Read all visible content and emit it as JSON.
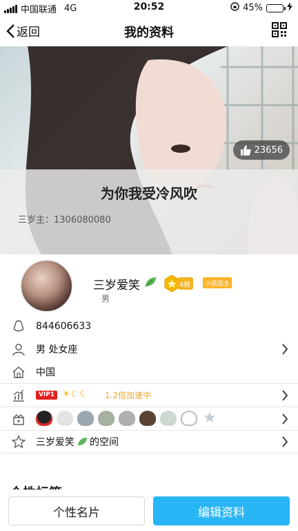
{
  "status_bar": {
    "carrier": "中国联通",
    "network": "4G",
    "time": "20:52",
    "battery": "45%",
    "battery_level": 0.45
  },
  "nav": {
    "back_label": "返回",
    "title": "我的资料"
  },
  "hero": {
    "likes": "23656",
    "signature": "为你我受冷风吹",
    "owner": "三岁主：1306080080"
  },
  "profile": {
    "name": "三岁爱笑",
    "gender": "男",
    "medal_label": "4枚",
    "shop_badge": "小店店主"
  },
  "rows": {
    "qq_number": "844606633",
    "gender_zodiac": "男 处女座",
    "location": "中国",
    "vip_label": "VIP1",
    "speed_label": "1.2倍加速中",
    "space_label": "三岁爱笑",
    "space_suffix": "的空间"
  },
  "section_peek": "个性标签",
  "bottom": {
    "card_label": "个性名片",
    "edit_label": "编辑资料"
  },
  "colors": {
    "accent": "#29b6f6",
    "vip_red": "#e0201e",
    "gold": "#f5a623"
  }
}
